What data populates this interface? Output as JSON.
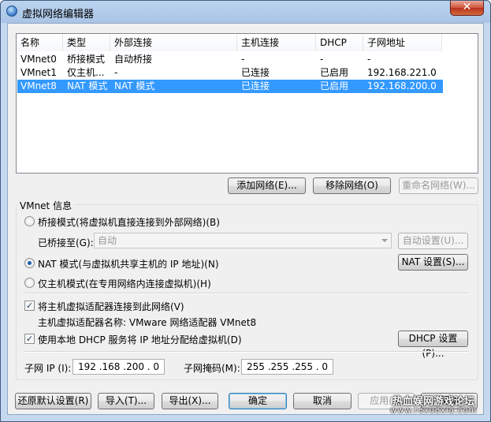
{
  "window": {
    "title": "虚拟网络编辑器",
    "close": "✕"
  },
  "list": {
    "columns": [
      "名称",
      "类型",
      "外部连接",
      "主机连接",
      "DHCP",
      "子网地址"
    ],
    "rows": [
      {
        "name": "VMnet0",
        "type": "桥接模式",
        "external": "自动桥接",
        "host": "-",
        "dhcp": "-",
        "subnet": "-"
      },
      {
        "name": "VMnet1",
        "type": "仅主机...",
        "external": "-",
        "host": "已连接",
        "dhcp": "已启用",
        "subnet": "192.168.221.0"
      },
      {
        "name": "VMnet8",
        "type": "NAT 模式",
        "external": "NAT 模式",
        "host": "已连接",
        "dhcp": "已启用",
        "subnet": "192.168.200.0"
      }
    ],
    "selected_row": 2
  },
  "list_buttons": {
    "add": "添加网络(E)...",
    "remove": "移除网络(O)",
    "rename": "重命名网络(W)..."
  },
  "vmnet_info": {
    "title": "VMnet 信息",
    "bridged_radio": "桥接模式(将虚拟机直接连接到外部网络)(B)",
    "bridged_to_label": "已桥接至(G):",
    "bridged_to_value": "自动",
    "auto_settings": "自动设置(U)...",
    "nat_radio": "NAT 模式(与虚拟机共享主机的 IP 地址)(N)",
    "nat_settings": "NAT 设置(S)...",
    "hostonly_radio": "仅主机模式(在专用网络内连接虚拟机)(H)",
    "selected_mode": "nat",
    "connect_adapter": "将主机虚拟适配器连接到此网络(V)",
    "adapter_name": "主机虚拟适配器名称: VMware 网络适配器 VMnet8",
    "use_dhcp": "使用本地 DHCP 服务将 IP 地址分配给虚拟机(D)",
    "dhcp_settings": "DHCP 设置(P)...",
    "subnet_ip_label": "子网 IP (I):",
    "subnet_ip_value": "192 .168 .200 . 0",
    "subnet_mask_label": "子网掩码(M):",
    "subnet_mask_value": "255 .255 .255 . 0"
  },
  "footer_buttons": {
    "restore": "还原默认设置(R)",
    "import": "导入(T)...",
    "export": "导出(X)...",
    "ok": "确定",
    "cancel": "取消",
    "apply": "应用(A)",
    "help": "帮助"
  },
  "watermark": {
    "line1": "热血娱网游戏论坛",
    "line2": "www.rexuexia.com"
  },
  "colors": {
    "selection": "#3399ff",
    "title_bar": "#a9c4e6",
    "close_button": "#c9422a"
  }
}
